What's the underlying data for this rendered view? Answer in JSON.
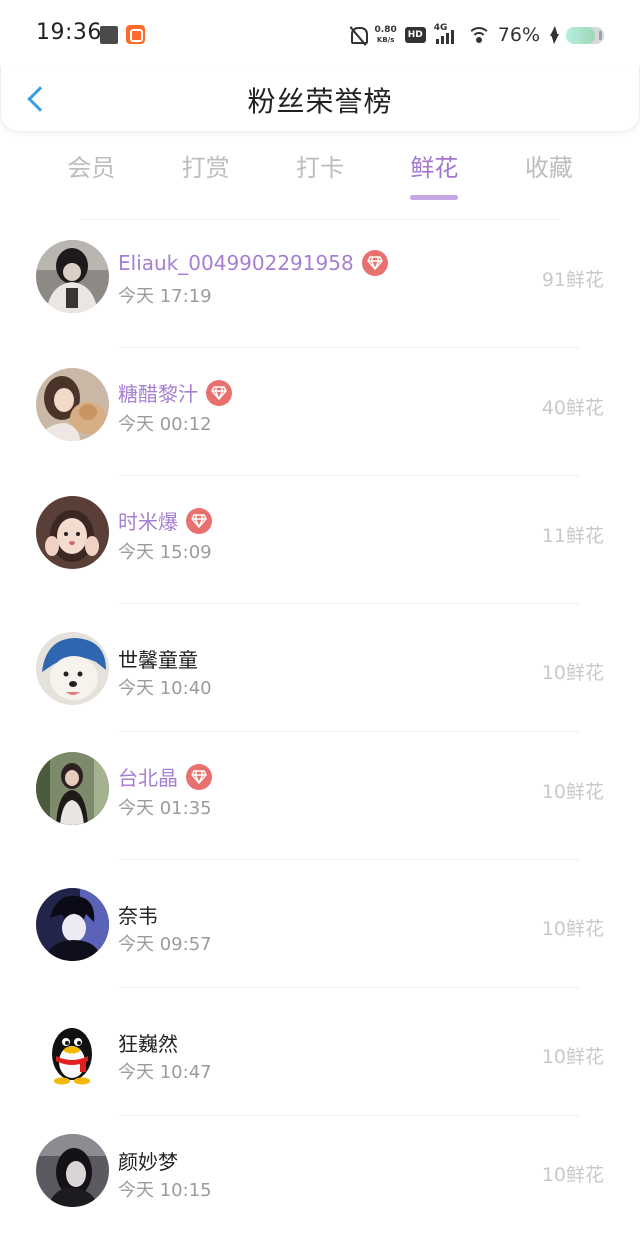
{
  "status_bar": {
    "time": "19:36",
    "net_speed_value": "0.80",
    "net_speed_unit": "KB/s",
    "hd_label": "HD",
    "network_label": "4G",
    "battery_text": "76%",
    "battery_level": 0.76
  },
  "header": {
    "title": "粉丝荣誉榜"
  },
  "tabs": [
    {
      "label": "会员",
      "active": false
    },
    {
      "label": "打赏",
      "active": false
    },
    {
      "label": "打卡",
      "active": false
    },
    {
      "label": "鲜花",
      "active": true
    },
    {
      "label": "收藏",
      "active": false
    }
  ],
  "fans": [
    {
      "name": "Eliauk_0049902291958",
      "time": "今天 17:19",
      "count": "91鲜花",
      "vip": true,
      "avatar": "dark-haired-figure-avatar"
    },
    {
      "name": "糖醋黎汁",
      "time": "今天 00:12",
      "count": "40鲜花",
      "vip": true,
      "avatar": "girl-with-cat-avatar"
    },
    {
      "name": "时米爆",
      "time": "今天 15:09",
      "count": "11鲜花",
      "vip": true,
      "avatar": "girl-hands-on-cheeks-avatar"
    },
    {
      "name": "世馨童童",
      "time": "今天 10:40",
      "count": "10鲜花",
      "vip": false,
      "avatar": "dog-in-shark-hat-avatar"
    },
    {
      "name": "台北晶",
      "time": "今天 01:35",
      "count": "10鲜花",
      "vip": true,
      "avatar": "woman-in-forest-avatar"
    },
    {
      "name": "奈韦",
      "time": "今天 09:57",
      "count": "10鲜花",
      "vip": false,
      "avatar": "anime-boy-avatar"
    },
    {
      "name": "狂巍然",
      "time": "今天 10:47",
      "count": "10鲜花",
      "vip": false,
      "avatar": "penguin-avatar"
    },
    {
      "name": "颜妙梦",
      "time": "今天 10:15",
      "count": "10鲜花",
      "vip": false,
      "avatar": "dark-portrait-avatar"
    }
  ],
  "colors": {
    "accent": "#a576cf",
    "vip_name": "#a67fd3",
    "badge": "#e8716f",
    "back_arrow": "#3a9ee8",
    "muted": "#9b9b9b"
  }
}
